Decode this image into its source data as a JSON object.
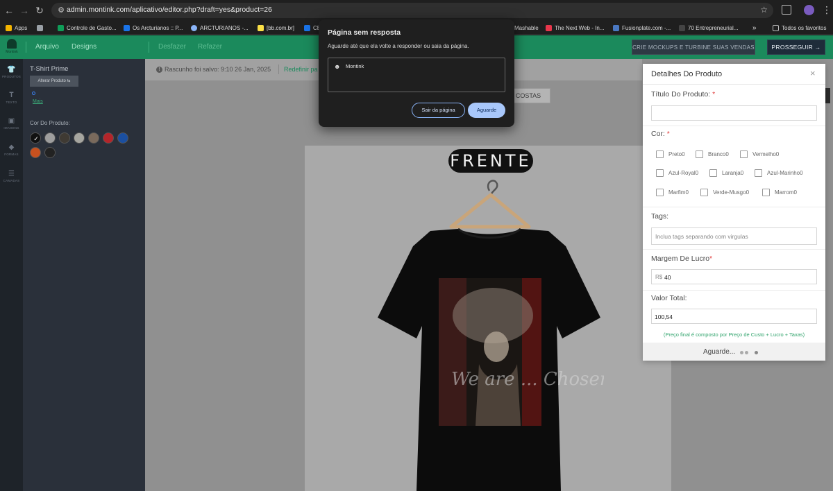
{
  "browser": {
    "url": "admin.montink.com/aplicativo/editor.php?draft=yes&product=26",
    "bookmarks": [
      {
        "label": "Apps",
        "color": "#f4b400"
      },
      {
        "label": "",
        "color": "#9aa0a6"
      },
      {
        "label": "Controle de Gasto...",
        "color": "#0f9d58"
      },
      {
        "label": "Os Arcturianos :: P...",
        "color": "#1a73e8"
      },
      {
        "label": "ARCTURIANOS -...",
        "color": "#8ab4f8"
      },
      {
        "label": "[bb.com.br]",
        "color": "#fbe046"
      },
      {
        "label": "CE",
        "color": "#1a73e8"
      },
      {
        "label": "Mashable",
        "color": "#ffffff"
      },
      {
        "label": "The Next Web - In...",
        "color": "#e8364b"
      },
      {
        "label": "Fusionplate.com -...",
        "color": "#4a78c2"
      },
      {
        "label": "70 Entrepreneurial...",
        "color": "#444444"
      },
      {
        "label": "»",
        "color": ""
      },
      {
        "label": "Todos os favoritos",
        "color": "#bdbdbd"
      }
    ]
  },
  "header": {
    "logo_text": "Montink",
    "menu": [
      "Arquivo",
      "Designs"
    ],
    "undo": "Desfazer",
    "redo": "Refazer",
    "mockup_button": "CRIE MOCKUPS E TURBINE SUAS VENDAS",
    "proceed_button": "PROSSEGUIR →"
  },
  "rail": [
    {
      "label": "PRODUTOS",
      "icon": "shirt-icon"
    },
    {
      "label": "TEXTO",
      "icon": "text-icon"
    },
    {
      "label": "IMAGENS",
      "icon": "image-icon"
    },
    {
      "label": "FORMAS",
      "icon": "shapes-icon"
    },
    {
      "label": "CAMADAS",
      "icon": "layers-icon"
    }
  ],
  "left_panel": {
    "product_title": "T-Shirt Prime",
    "change_product": "Alterar Produto ⇆",
    "more": "Mais",
    "color_label": "Cor Do Produto:",
    "swatches": [
      "#111111",
      "#9e9e9e",
      "#3f3a33",
      "#a6a6a0",
      "#7a6a5c",
      "#b3252a",
      "#1b4fa0",
      "#c7511f",
      "#222222"
    ],
    "selected_swatch": 0
  },
  "draft": {
    "info_icon": "!",
    "text": "Rascunho foi salvo: 9:10 26 Jan, 2025",
    "reset": "Redefinir pa"
  },
  "canvas": {
    "costas": "COSTAS",
    "frente": "FRENTE",
    "artwork_script": "We are ... Chosen"
  },
  "dialog": {
    "title": "Página sem resposta",
    "message": "Aguarde até que ela volte a responder ou saia da página.",
    "item": "Montink",
    "exit": "Sair da página",
    "wait": "Aguarde"
  },
  "details": {
    "title": "Detalhes Do Produto",
    "close": "×",
    "product_title_label": "Título Do Produto:",
    "product_title_value": "",
    "required_mark": "*",
    "color_label": "Cor:",
    "colors": [
      "Preto0",
      "Branco0",
      "Vermelho0",
      "Azul-Royal0",
      "Laranja0",
      "Azul-Marinho0",
      "Marfim0",
      "Verde-Musgo0",
      "Marrom0"
    ],
    "tags_label": "Tags:",
    "tags_placeholder": "Inclua tags separando com virgulas",
    "margin_label": "Margem De Lucro",
    "currency": "R$",
    "margin_value": "40",
    "total_label": "Valor Total:",
    "total_value": "100,54",
    "price_note": "(Preço final é composto por Preço de Custo + Lucro + Taxas)",
    "footer_wait": "Aguarde..."
  }
}
